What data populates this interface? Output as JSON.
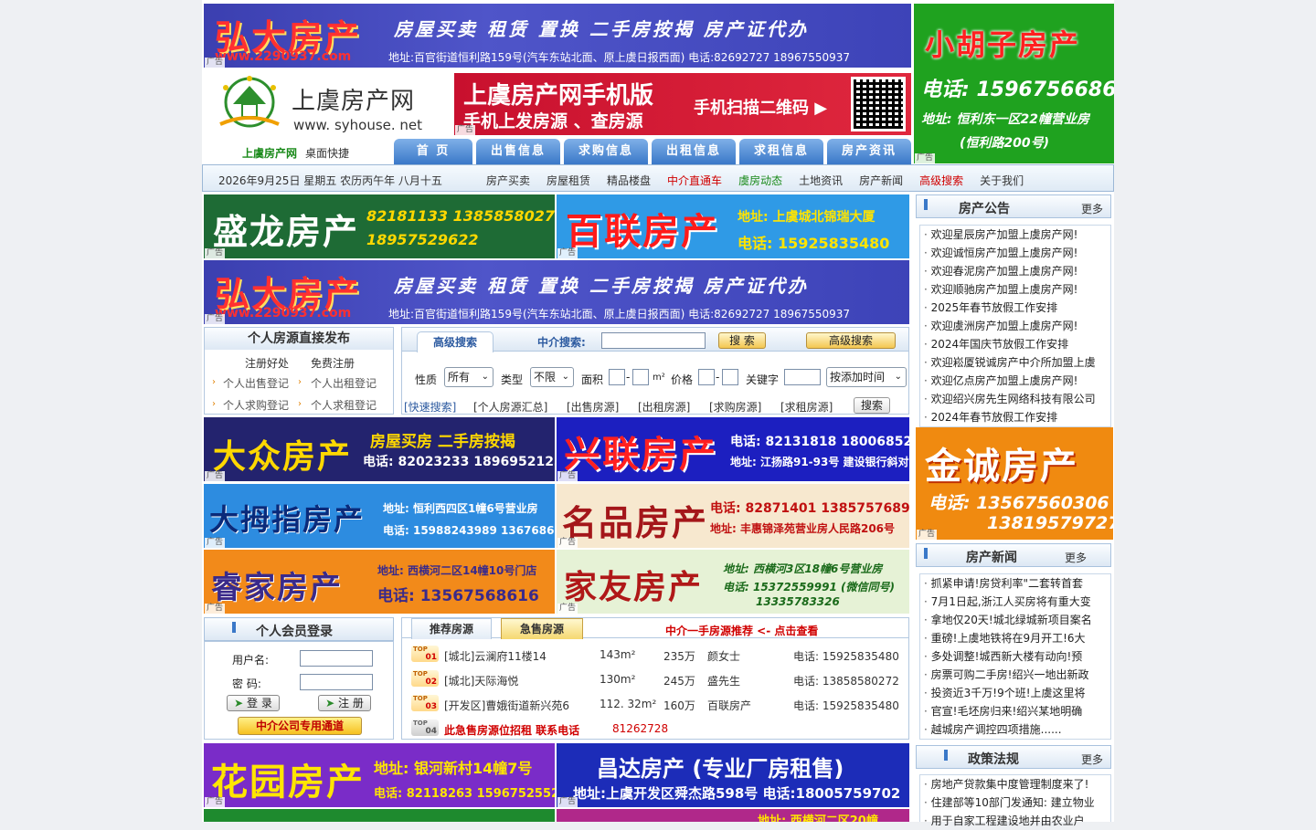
{
  "ad_label": "广告",
  "hongda_top": {
    "name": "弘大房产",
    "services": "房屋买卖  租赁  置换  二手房按揭  房产证代办",
    "url": "www.2290937.com",
    "contact": "地址:百官街道恒利路159号(汽车东站北面、原上虞日报西面)   电话:82692727  18967550937"
  },
  "xiaohuzi": {
    "name": "小胡子房产",
    "phone": "电话: 15967566868",
    "address": "地址: 恒利东一区22幢营业房",
    "address2": "(恒利路200号)"
  },
  "logo": {
    "cn": "上虞房产网",
    "en": "www. syhouse. net",
    "quick": "上虞房产网",
    "quick2": "桌面快捷"
  },
  "mobile_ad": {
    "title": "上虞房产网手机版",
    "sub": "手机上发房源 、查房源",
    "cta": "手机扫描二维码 ▶"
  },
  "nav_tabs": [
    "首  页",
    "出售信息",
    "求购信息",
    "出租信息",
    "求租信息",
    "房产资讯"
  ],
  "date_bar": {
    "date": "2026年9月25日  星期五  农历丙午年  八月十五",
    "links": [
      {
        "t": "房产买卖",
        "c": "#333"
      },
      {
        "t": "房屋租赁",
        "c": "#333"
      },
      {
        "t": "精品楼盘",
        "c": "#333"
      },
      {
        "t": "中介直通车",
        "c": "#d00000"
      },
      {
        "t": "虞房动态",
        "c": "#1a8a1a"
      },
      {
        "t": "土地资讯",
        "c": "#333"
      },
      {
        "t": "房产新闻",
        "c": "#333"
      },
      {
        "t": "高级搜索",
        "c": "#d00000"
      },
      {
        "t": "关于我们",
        "c": "#333"
      }
    ]
  },
  "shenglong": {
    "name": "盛龙房产",
    "phones": "82181133  13858580272",
    "phone2": "18957529622"
  },
  "bailian": {
    "name": "百联房产",
    "address": "地址: 上虞城北锦瑞大厦",
    "phone": "电话: 15925835480"
  },
  "announce": {
    "title": "房产公告",
    "more": "更多",
    "items": [
      "欢迎星辰房产加盟上虞房产网!",
      "欢迎诚恒房产加盟上虞房产网!",
      "欢迎春泥房产加盟上虞房产网!",
      "欢迎顺驰房产加盟上虞房产网!",
      "2025年春节放假工作安排",
      "欢迎虞洲房产加盟上虞房产网!",
      "2024年国庆节放假工作安排",
      "欢迎崧厦锐诚房产中介所加盟上虞",
      "欢迎亿点房产加盟上虞房产网!",
      "欢迎绍兴房先生网络科技有限公司",
      "2024年春节放假工作安排"
    ]
  },
  "personal": {
    "title": "个人房源直接发布",
    "reg1": "注册好处",
    "reg2": "免费注册",
    "l1": "个人出售登记",
    "l2": "个人出租登记",
    "l3": "个人求购登记",
    "l4": "个人求租登记"
  },
  "search": {
    "tab": "高级搜索",
    "agent_label": "中介搜索:",
    "search_btn": "搜 索",
    "adv_btn": "高级搜索",
    "nature": "性质",
    "nature_val": "所有",
    "type": "类型",
    "type_val": "不限",
    "area": "面积",
    "area_unit": "m²",
    "price": "价格",
    "keyword": "关键字",
    "sort": "按添加时间",
    "quick": "[快速搜索]",
    "q1": "[个人房源汇总]",
    "q2": "[出售房源]",
    "q3": "[出租房源]",
    "q4": "[求购房源]",
    "q5": "[求租房源]",
    "q_btn": "搜索"
  },
  "dazhong": {
    "name": "大众房产",
    "services": "房屋买房  二手房按揭",
    "phone": "电话: 82023233  18969521233"
  },
  "xinglian": {
    "name": "兴联房产",
    "phone": "电话: 82131818  18006852766",
    "address": "地址: 江扬路91-93号 建设银行斜对面"
  },
  "jincheng": {
    "name": "金诚房产",
    "phone": "电话:  13567560306",
    "phone2": "13819579727"
  },
  "damuzhi": {
    "name": "大拇指房产",
    "address": "地址: 恒利西四区1幢6号营业房",
    "phone": "电话: 15988243989  13676860016"
  },
  "mingpin": {
    "name": "名品房产",
    "phone": "电话: 82871401   13857576897",
    "address": "地址: 丰惠锦泽苑营业房人民路206号"
  },
  "news": {
    "title": "房产新闻",
    "more": "更多",
    "items": [
      "抓紧申请!房贷利率\"二套转首套",
      "7月1日起,浙江人买房将有重大变",
      "拿地仅20天!城北绿城新项目案名",
      "重磅!上虞地铁将在9月开工!6大",
      "多处调整!城西新大楼有动向!预",
      "房票可购二手房!绍兴一地出新政",
      "投资近3千万!9个班!上虞这里将",
      "官宣!毛坯房归来!绍兴某地明确",
      "越城房产调控四项措施......"
    ]
  },
  "ruijia": {
    "name": "睿家房产",
    "address": "地址: 西横河二区14幢10号门店",
    "phone": "电话: 13567568616"
  },
  "jiayou": {
    "name": "家友房产",
    "address": "地址: 西横河3区18幢6号营业房",
    "phone": "电话: 15372559991 (微信同号)",
    "phone2": "13335783326"
  },
  "login": {
    "title": "个人会员登录",
    "user": "用户名:",
    "pass": "密    码:",
    "login_btn": "登 录",
    "reg_btn": "注 册",
    "agent_btn": "中介公司专用通道"
  },
  "listings": {
    "tab1": "推荐房源",
    "tab2": "急售房源",
    "promo": "中介一手房源推荐 <- 点击查看",
    "rows": [
      {
        "n": "01",
        "t": "[城北]云澜府11楼14",
        "a": "143m²",
        "p": "235万",
        "c": "颜女士",
        "ph": "电话: 15925835480"
      },
      {
        "n": "02",
        "t": "[城北]天际海悦",
        "a": "130m²",
        "p": "245万",
        "c": "盛先生",
        "ph": "电话: 13858580272"
      },
      {
        "n": "03",
        "t": "[开发区]曹娥街道新兴苑6",
        "a": "112. 32m²",
        "p": "160万",
        "c": "百联房产",
        "ph": "电话: 15925835480"
      }
    ],
    "row4": "此急售房源位招租  联系电话",
    "row4_phone": "81262728",
    "top": "TOP"
  },
  "policy": {
    "title": "政策法规",
    "more": "更多",
    "items": [
      "房地产贷款集中度管理制度来了!",
      "住建部等10部门发通知: 建立物业",
      "用于自家工程建设地并由农业户"
    ]
  },
  "huayuan": {
    "name": "花园房产",
    "address": "地址: 银河新村14幢7号",
    "phone": "电话: 82118263  15967525524"
  },
  "changda": {
    "title": "昌达房产 (专业厂房租售)",
    "info": "地址:上虞开发区舜杰路598号  电话:18005759702"
  },
  "bottom_partial": "地址:  西横河二区20幢",
  "colors": {
    "nav": "#3a78c8",
    "accent": "#d00000",
    "green": "#1a8a1a"
  }
}
